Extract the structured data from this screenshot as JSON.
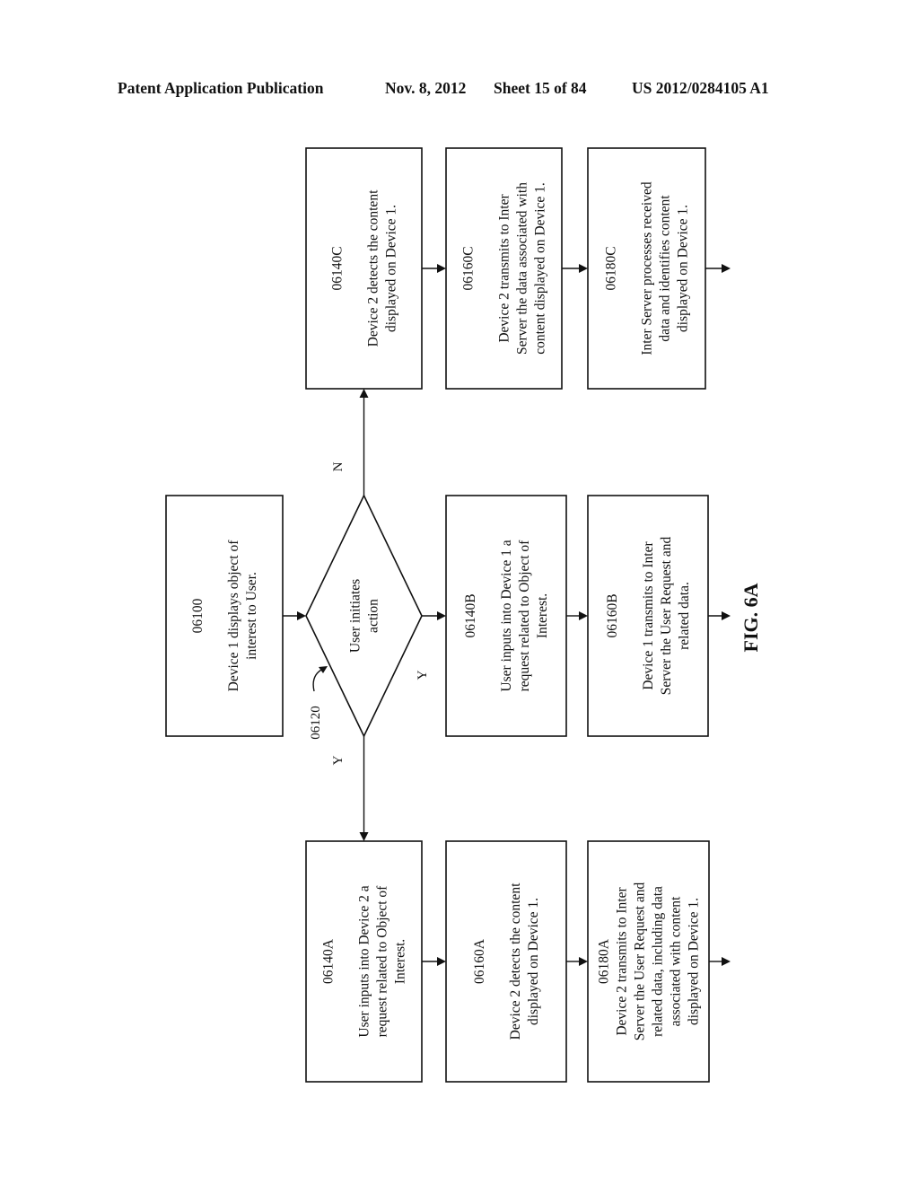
{
  "header": {
    "publication": "Patent Application Publication",
    "date": "Nov. 8, 2012",
    "sheet": "Sheet 15 of 84",
    "number": "US 2012/0284105 A1"
  },
  "figure_label": "FIG. 6A",
  "orientation": "rotated 90° counter-clockwise (text reads bottom-to-top)",
  "nodes": [
    {
      "id": "06100",
      "type": "process",
      "lines": [
        "06100",
        "",
        "Device 1 displays object of",
        "interest to User."
      ]
    },
    {
      "id": "06120",
      "type": "decision",
      "ref_label": "06120",
      "lines": [
        "User initiates",
        "action"
      ]
    },
    {
      "id": "06140A",
      "type": "process",
      "lines": [
        "06140A",
        "",
        "User inputs into Device 2 a",
        "request related to Object of",
        "Interest."
      ]
    },
    {
      "id": "06140B",
      "type": "process",
      "lines": [
        "06140B",
        "",
        "User inputs into Device 1 a",
        "request related to Object of",
        "Interest."
      ]
    },
    {
      "id": "06140C",
      "type": "process",
      "lines": [
        "06140C",
        "",
        "Device 2 detects the content",
        "displayed on Device 1."
      ]
    },
    {
      "id": "06160A",
      "type": "process",
      "lines": [
        "06160A",
        "",
        "Device 2 detects the content",
        "displayed on Device 1."
      ]
    },
    {
      "id": "06160B",
      "type": "process",
      "lines": [
        "06160B",
        "",
        "Device 1 transmits to Inter",
        "Server the User Request and",
        "related data."
      ]
    },
    {
      "id": "06160C",
      "type": "process",
      "lines": [
        "06160C",
        "",
        "Device 2 transmits to Inter",
        "Server the data associated with",
        "content displayed on Device 1."
      ]
    },
    {
      "id": "06180A",
      "type": "process",
      "lines": [
        "06180A",
        "Device 2 transmits to Inter",
        "Server the User Request and",
        "related data, including data",
        "associated with content",
        "displayed on Device 1."
      ]
    },
    {
      "id": "06180C",
      "type": "process",
      "lines": [
        "06180C",
        "",
        "Inter Server processes received",
        "data and identifies content",
        "displayed on Device 1."
      ]
    }
  ],
  "edges": [
    {
      "from": "06100",
      "to": "06120",
      "label": ""
    },
    {
      "from": "06120",
      "to": "06140A",
      "label": "Y"
    },
    {
      "from": "06120",
      "to": "06140B",
      "label": "Y"
    },
    {
      "from": "06120",
      "to": "06140C",
      "label": "N"
    },
    {
      "from": "06140A",
      "to": "06160A",
      "label": ""
    },
    {
      "from": "06140B",
      "to": "06160B",
      "label": ""
    },
    {
      "from": "06140C",
      "to": "06160C",
      "label": ""
    },
    {
      "from": "06160A",
      "to": "06180A",
      "label": ""
    },
    {
      "from": "06160C",
      "to": "06180C",
      "label": ""
    },
    {
      "from": "06180A",
      "to": "continuation",
      "label": ""
    },
    {
      "from": "06160B",
      "to": "continuation",
      "label": ""
    },
    {
      "from": "06180C",
      "to": "continuation",
      "label": ""
    }
  ]
}
